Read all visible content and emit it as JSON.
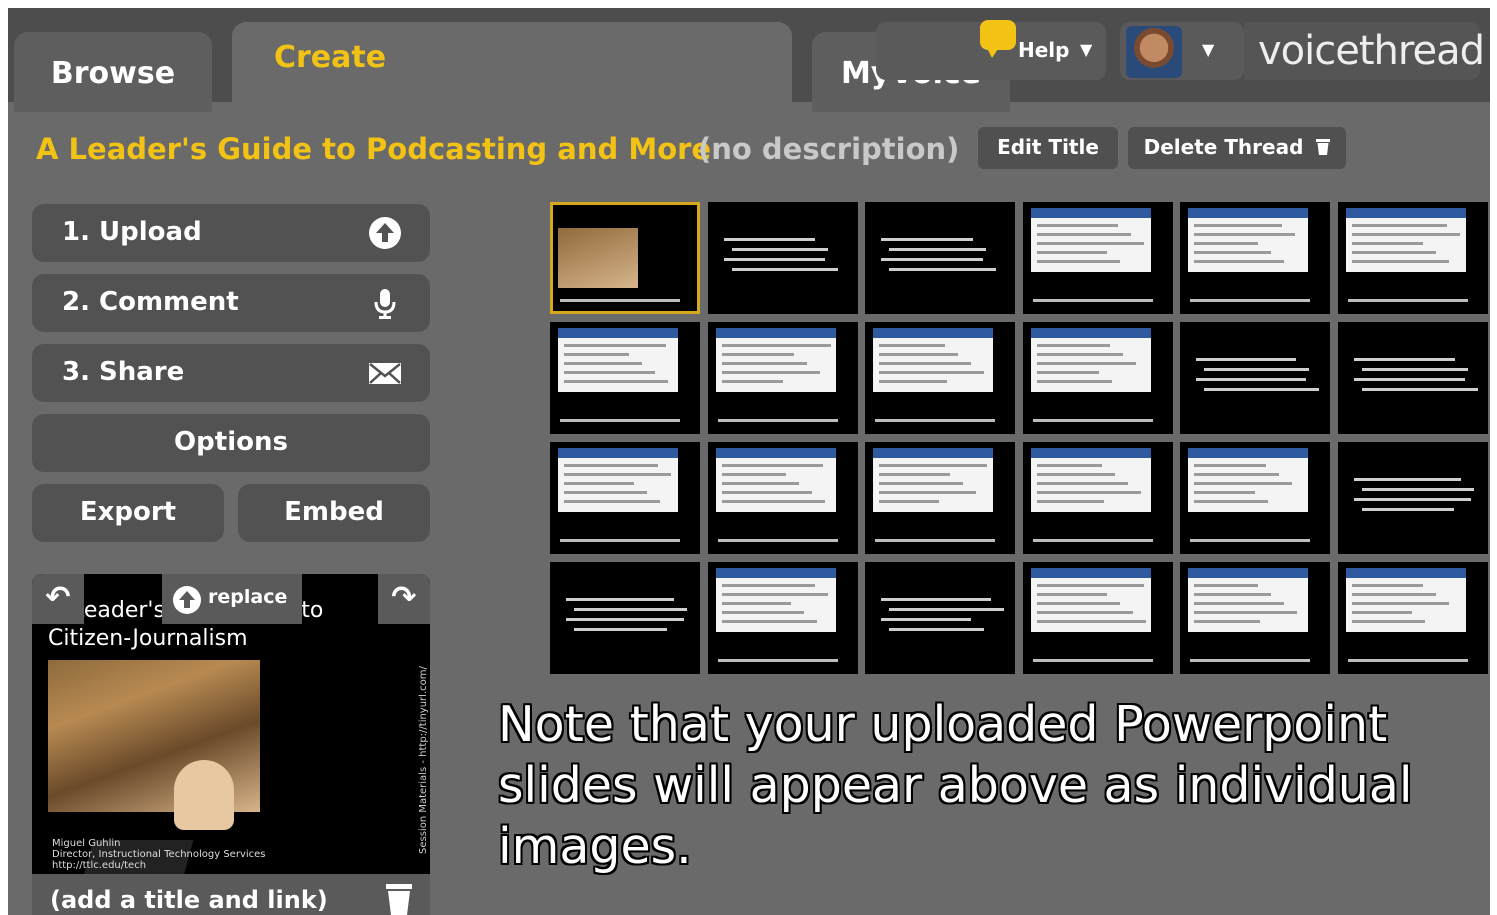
{
  "tabs": {
    "browse": "Browse",
    "create": "Create",
    "myvoice": "MyVoice"
  },
  "header": {
    "help": "Help",
    "logo": "voicethread"
  },
  "thread": {
    "title": "A Leader's Guide to Podcasting and More",
    "description": "(no description)",
    "edit_title": "Edit Title",
    "delete_thread": "Delete Thread"
  },
  "steps": {
    "upload": "1. Upload",
    "comment": "2. Comment",
    "share": "3. Share",
    "options": "Options",
    "export": "Export",
    "embed": "Embed"
  },
  "preview": {
    "replace": "replace",
    "line1": "Leader's Field Guide to",
    "line2": "Citizen-Journalism",
    "caption_name": "Miguel Guhlin",
    "caption_role": "Director, Instructional Technology Services",
    "caption_url": "http://ttlc.edu/tech",
    "side_text": "Session Materials - http://tinyurl.com/",
    "add_title": "(add a title and link)"
  },
  "slides_count": 24,
  "note": "Note that your uploaded Powerpoint slides will appear above as individual images.",
  "colors": {
    "accent": "#f2c314",
    "panel": "#6a6a6a",
    "button": "#525252",
    "selected_outline": "#d6a81e"
  }
}
